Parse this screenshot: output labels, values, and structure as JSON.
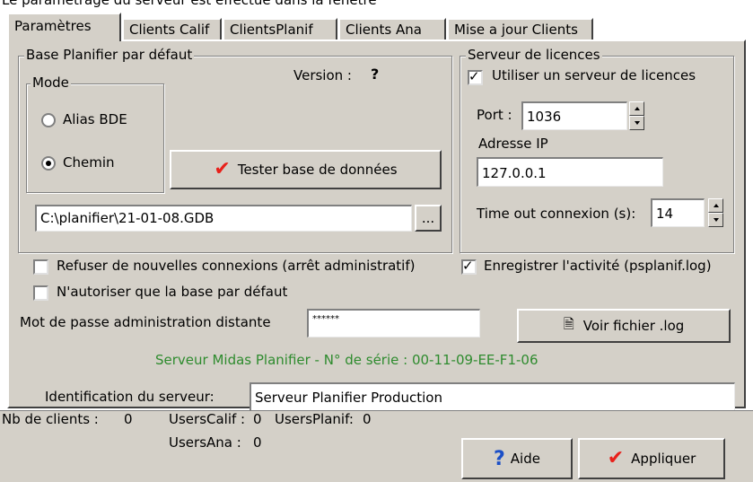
{
  "top_fragment": "Le paramétrage du serveur est effectué dans la fenêtre",
  "tabs": [
    {
      "label": "Paramètres",
      "active": true
    },
    {
      "label": "Clients Calif",
      "active": false
    },
    {
      "label": "ClientsPlanif",
      "active": false
    },
    {
      "label": "Clients Ana",
      "active": false
    },
    {
      "label": "Mise a jour Clients",
      "active": false
    }
  ],
  "base": {
    "title": "Base Planifier par défaut",
    "version_label": "Version :",
    "version_value": "?",
    "mode_title": "Mode",
    "mode_options": [
      {
        "label": "Alias BDE",
        "selected": false
      },
      {
        "label": "Chemin",
        "selected": true
      }
    ],
    "test_button": "Tester base de données",
    "path_value": "C:\\planifier\\21-01-08.GDB",
    "browse_button": "..."
  },
  "license": {
    "title": "Serveur de licences",
    "use_server_label": "Utiliser un serveur de licences",
    "use_server_checked": true,
    "port_label": "Port :",
    "port_value": "1036",
    "ip_label": "Adresse IP",
    "ip_value": "127.0.0.1",
    "timeout_label": "Time out connexion (s):",
    "timeout_value": "14"
  },
  "options": {
    "refuse_label": "Refuser de nouvelles connexions (arrêt administratif)",
    "refuse_checked": false,
    "log_activity_label": "Enregistrer l'activité (psplanif.log)",
    "log_activity_checked": true,
    "default_only_label": "N'autoriser que la base par défaut",
    "default_only_checked": false
  },
  "admin": {
    "password_label": "Mot de passe administration distante",
    "password_value": "******",
    "view_log_button": "Voir fichier .log"
  },
  "serial_text": "Serveur Midas Planifier - N° de série : 00-11-09-EE-F1-06",
  "server_id": {
    "label": "Identification du serveur:",
    "value": "Serveur Planifier Production"
  },
  "status": {
    "clients_label": "Nb de clients :",
    "clients_value": "0",
    "calif_label": "UsersCalif :",
    "calif_value": "0",
    "planif_label": "UsersPlanif:",
    "planif_value": "0",
    "ana_label": "UsersAna :",
    "ana_value": "0"
  },
  "buttons": {
    "help": "Aide",
    "apply": "Appliquer"
  },
  "icons": {
    "check_symbol": "✔",
    "checkbox_symbol": "✓",
    "help_symbol": "?",
    "document_symbol": "🗎"
  },
  "colors": {
    "face": "#d4d0c8",
    "serial_text": "#2e8b2e",
    "check_red": "#e8201a",
    "help_blue": "#1b4fc7"
  }
}
